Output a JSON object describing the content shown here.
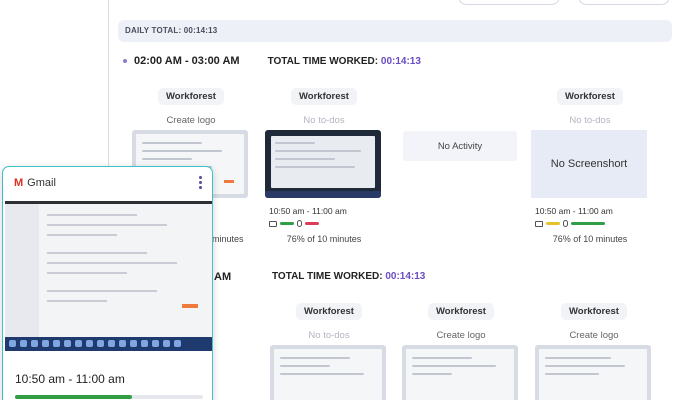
{
  "daily": {
    "label": "DAILY TOTAL:",
    "value": "00:14:13"
  },
  "hours": [
    {
      "range": "02:00 AM - 03:00 AM",
      "total_label": "TOTAL TIME WORKED:",
      "total_value": "00:14:13"
    },
    {
      "range": "AM",
      "total_label": "TOTAL TIME WORKED:",
      "total_value": "00:14:13"
    }
  ],
  "row1": [
    {
      "project": "Workforest",
      "todo": "Create logo",
      "time": "10:50 am - 11:00 am",
      "pct": "minutes"
    },
    {
      "project": "Workforest",
      "todo": "No to-dos",
      "time": "10:50 am - 11:00 am",
      "pct": "76% of 10 minutes"
    },
    {
      "no_activity": "No Activity"
    },
    {
      "project": "Workforest",
      "todo": "No to-dos",
      "no_screenshot": "No Screenshort",
      "time": "10:50 am - 11:00 am",
      "pct": "76% of 10 minutes"
    }
  ],
  "row2": [
    {
      "project": "Workforest",
      "todo": "No to-dos"
    },
    {
      "project": "Workforest",
      "todo": "Create logo"
    },
    {
      "project": "Workforest",
      "todo": "Create logo"
    }
  ],
  "popup": {
    "app": "Gmail",
    "time": "10:50 am - 11:00 am",
    "progress": 0.62
  },
  "colors": {
    "accent": "#6a4cc4",
    "green": "#2f9e44",
    "yellow": "#e6c229",
    "red": "#e03a5a",
    "teal": "#3ec1c9"
  }
}
